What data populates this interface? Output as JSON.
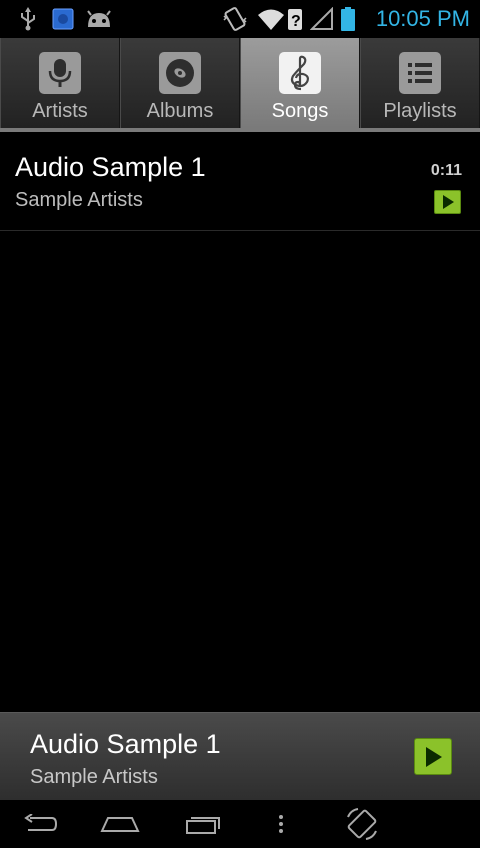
{
  "status_bar": {
    "time": "10:05 PM",
    "icons": [
      "usb-icon",
      "app-notification-icon",
      "android-icon",
      "vibrate-icon",
      "wifi-icon",
      "signal-icon",
      "battery-icon"
    ],
    "accent_color": "#33b5e5"
  },
  "tabs": [
    {
      "label": "Artists",
      "icon": "microphone-icon",
      "active": false
    },
    {
      "label": "Albums",
      "icon": "disc-icon",
      "active": false
    },
    {
      "label": "Songs",
      "icon": "treble-clef-icon",
      "active": true
    },
    {
      "label": "Playlists",
      "icon": "playlist-icon",
      "active": false
    }
  ],
  "songs": [
    {
      "title": "Audio Sample 1",
      "artist": "Sample Artists",
      "duration": "0:11"
    }
  ],
  "now_playing": {
    "title": "Audio Sample 1",
    "artist": "Sample Artists"
  },
  "nav_bar": {
    "buttons": [
      "back-icon",
      "home-icon",
      "recent-apps-icon",
      "menu-icon",
      "rotate-icon"
    ]
  },
  "colors": {
    "play_green": "#8bc22a"
  }
}
